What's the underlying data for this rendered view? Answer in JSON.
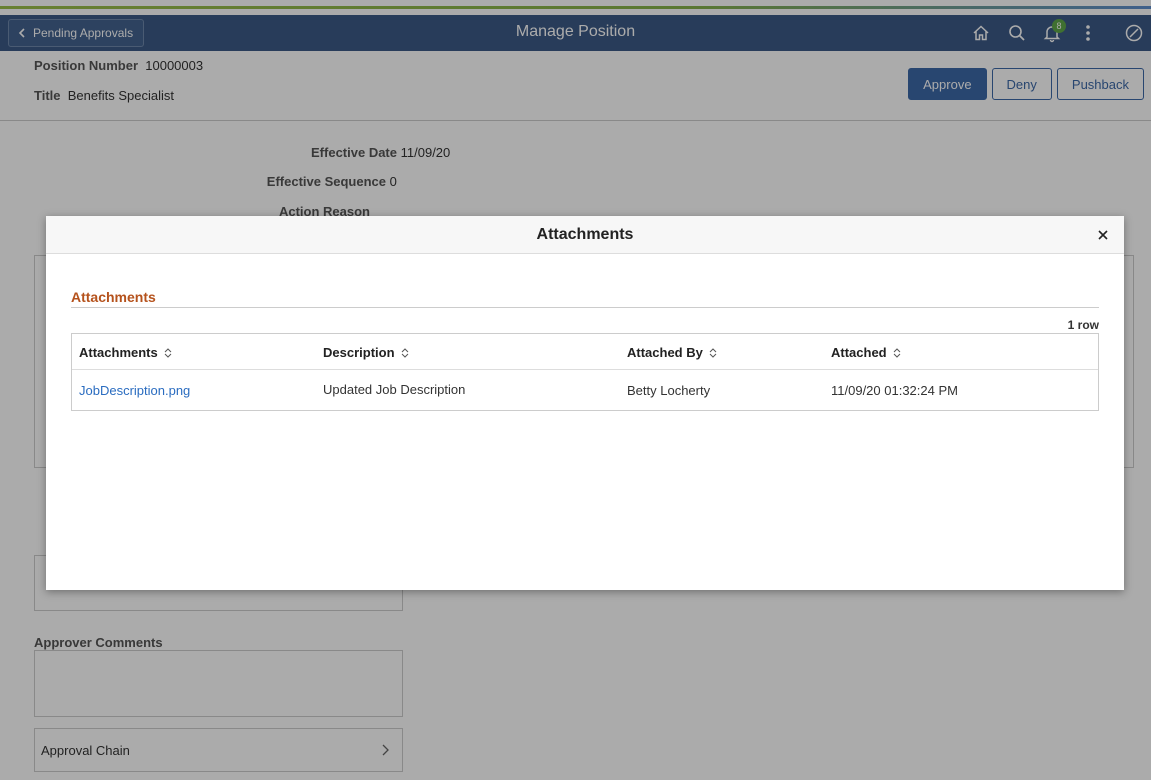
{
  "header": {
    "back_label": "Pending Approvals",
    "title": "Manage Position",
    "notification_count": "8"
  },
  "position": {
    "number_label": "Position Number",
    "number_value": "10000003",
    "title_label": "Title",
    "title_value": "Benefits Specialist"
  },
  "actions": {
    "approve": "Approve",
    "deny": "Deny",
    "pushback": "Pushback"
  },
  "fields": {
    "effective_date_label": "Effective Date",
    "effective_date_value": "11/09/20",
    "effective_seq_label": "Effective Sequence",
    "effective_seq_value": "0",
    "action_reason_label": "Action Reason"
  },
  "comments": {
    "approver_label": "Approver Comments"
  },
  "approval_chain": "Approval Chain",
  "modal": {
    "title": "Attachments",
    "group_title": "Attachments",
    "row_count": "1 row",
    "columns": [
      "Attachments",
      "Description",
      "Attached By",
      "Attached"
    ],
    "rows": [
      {
        "file": "JobDescription.png",
        "description": "Updated Job Description",
        "attached_by": "Betty Locherty",
        "attached": "11/09/20 01:32:24 PM"
      }
    ]
  }
}
